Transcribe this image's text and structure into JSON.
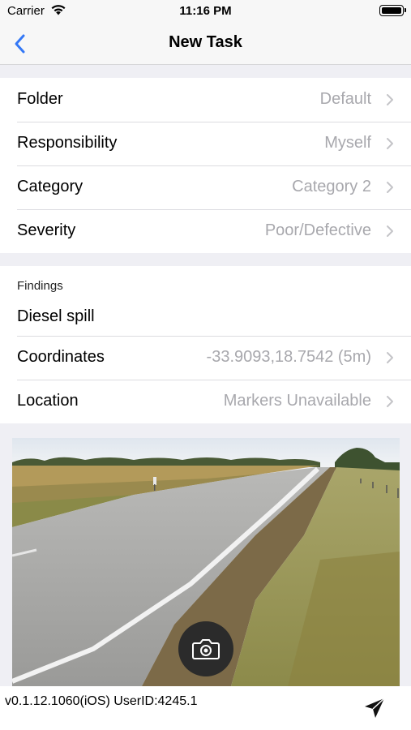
{
  "status_bar": {
    "carrier": "Carrier",
    "time": "11:16 PM"
  },
  "nav": {
    "title": "New Task",
    "back_icon": "chevron-left-icon",
    "accent": "#3478f6"
  },
  "details": [
    {
      "label": "Folder",
      "value": "Default"
    },
    {
      "label": "Responsibility",
      "value": "Myself"
    },
    {
      "label": "Category",
      "value": "Category 2"
    },
    {
      "label": "Severity",
      "value": "Poor/Defective"
    }
  ],
  "findings": {
    "label": "Findings",
    "text": "Diesel spill"
  },
  "location_rows": [
    {
      "label": "Coordinates",
      "value": "-33.9093,18.7542 (5m)"
    },
    {
      "label": "Location",
      "value": "Markers Unavailable"
    }
  ],
  "photo": {
    "subject": "roadside-photo",
    "camera_icon": "camera-icon"
  },
  "footer": {
    "version": "v0.1.12.1060(iOS) UserID:4245.1",
    "send_icon": "send-icon"
  }
}
